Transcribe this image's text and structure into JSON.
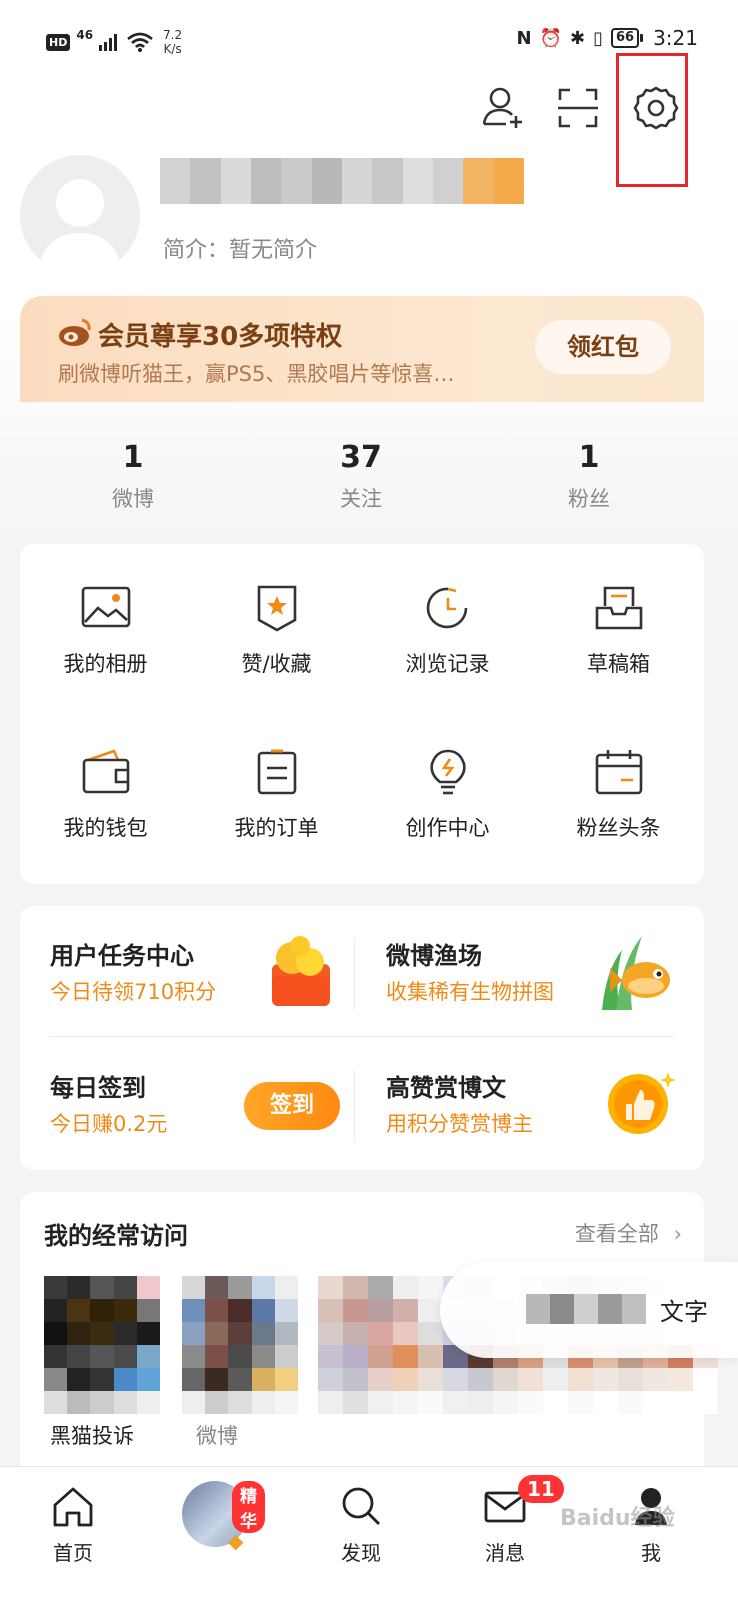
{
  "status_bar": {
    "hd": "HD",
    "network": "46",
    "speed_value": "7.2",
    "speed_unit": "K/s",
    "battery": "66",
    "time": "3:21"
  },
  "profile": {
    "bio": "简介：暂无简介"
  },
  "vip_banner": {
    "title": "会员尊享30多项特权",
    "subtitle": "刷微博听猫王，赢PS5、黑胶唱片等惊喜…",
    "button": "领红包"
  },
  "stats": [
    {
      "value": "1",
      "label": "微博"
    },
    {
      "value": "37",
      "label": "关注"
    },
    {
      "value": "1",
      "label": "粉丝"
    }
  ],
  "grid": [
    {
      "label": "我的相册",
      "icon": "photo-album-icon"
    },
    {
      "label": "赞/收藏",
      "icon": "favorite-star-icon"
    },
    {
      "label": "浏览记录",
      "icon": "history-clock-icon"
    },
    {
      "label": "草稿箱",
      "icon": "drafts-tray-icon"
    },
    {
      "label": "我的钱包",
      "icon": "wallet-icon"
    },
    {
      "label": "我的订单",
      "icon": "order-list-icon"
    },
    {
      "label": "创作中心",
      "icon": "lightbulb-icon"
    },
    {
      "label": "粉丝头条",
      "icon": "calendar-icon"
    }
  ],
  "tasks": {
    "task_center": {
      "title": "用户任务中心",
      "sub": "今日待领710积分"
    },
    "fishery": {
      "title": "微博渔场",
      "sub": "收集稀有生物拼图"
    },
    "signin": {
      "title": "每日签到",
      "sub": "今日赚0.2元",
      "button": "签到"
    },
    "reward": {
      "title": "高赞赏博文",
      "sub": "用积分赞赏博主"
    }
  },
  "frequent": {
    "title": "我的经常访问",
    "more": "查看全部",
    "item1_label": "黑猫投诉",
    "item2_label": "微博",
    "float_text": "文字"
  },
  "tabbar": [
    {
      "label": "首页"
    },
    {
      "label": "",
      "badge": "精华"
    },
    {
      "label": "发现"
    },
    {
      "label": "消息",
      "badge": "11"
    },
    {
      "label": "我"
    }
  ],
  "watermark": "Baidu经验",
  "colors": {
    "accent_orange": "#f08a17",
    "highlight_red": "#e5262b",
    "vip_brown": "#7a3f12"
  }
}
